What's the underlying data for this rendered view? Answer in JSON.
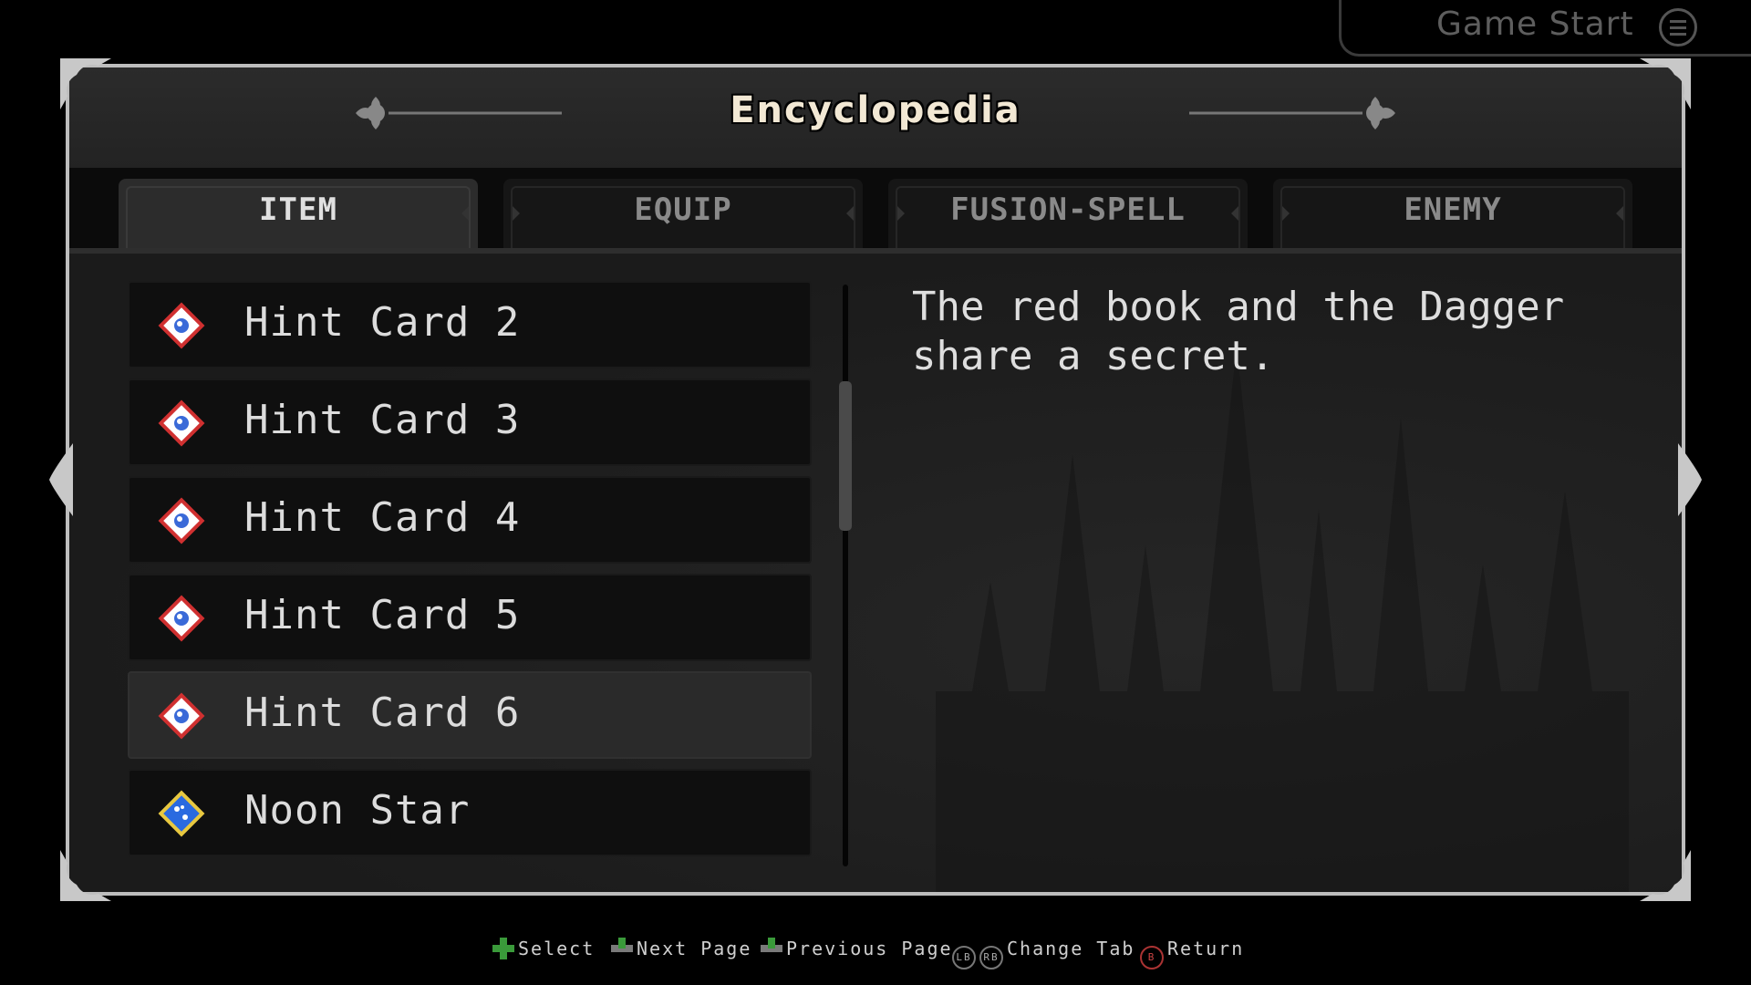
{
  "top_badge": {
    "label": "Game Start",
    "icon": "menu-icon"
  },
  "header": {
    "title": "Encyclopedia"
  },
  "tabs": [
    {
      "label": "ITEM",
      "active": true
    },
    {
      "label": "EQUIP",
      "active": false
    },
    {
      "label": "FUSION-SPELL",
      "active": false
    },
    {
      "label": "ENEMY",
      "active": false
    }
  ],
  "items": [
    {
      "name": "Hint Card 2",
      "icon": "hint-card-icon",
      "selected": false
    },
    {
      "name": "Hint Card 3",
      "icon": "hint-card-icon",
      "selected": false
    },
    {
      "name": "Hint Card 4",
      "icon": "hint-card-icon",
      "selected": false
    },
    {
      "name": "Hint Card 5",
      "icon": "hint-card-icon",
      "selected": false
    },
    {
      "name": "Hint Card 6",
      "icon": "hint-card-icon",
      "selected": true
    },
    {
      "name": "Noon Star",
      "icon": "star-card-icon",
      "selected": false
    }
  ],
  "description": "The red book and the Dagger share a secret.",
  "footer": {
    "select": "Select",
    "next_page": "Next Page",
    "previous_page": "Previous Page",
    "lb": "LB",
    "rb": "RB",
    "change_tab": "Change Tab",
    "b": "B",
    "return": "Return"
  },
  "colors": {
    "frame": "#bdbdbd",
    "panel": "#1f1f1f",
    "selected_row": "#2a2a2a",
    "dpad_green": "#3a9a3a",
    "hint_card_red": "#d03030",
    "star_card_blue": "#2a6ae0"
  }
}
